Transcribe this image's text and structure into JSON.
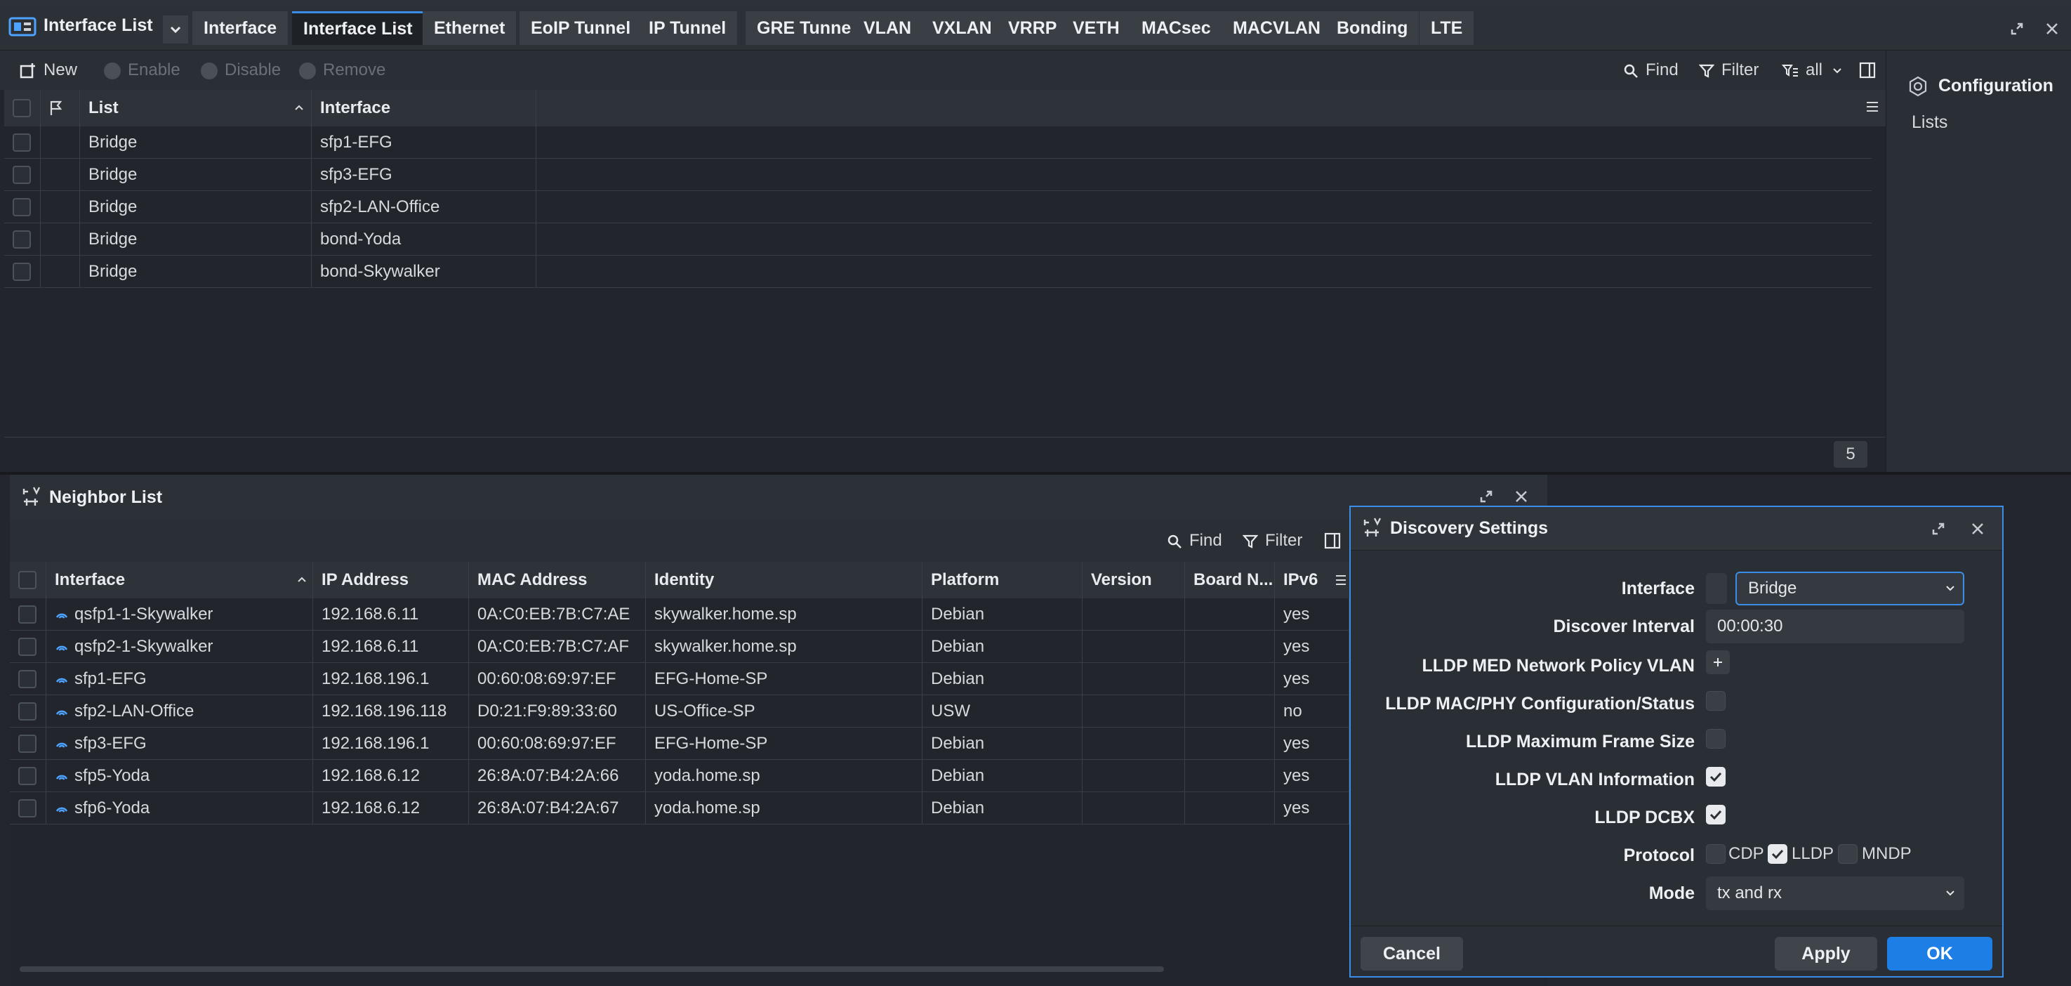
{
  "interface_window": {
    "title": "Interface List",
    "tabs": [
      {
        "label": "Interface",
        "active": false
      },
      {
        "label": "Interface List",
        "active": true
      },
      {
        "label": "Ethernet",
        "active": false
      },
      {
        "label": "EoIP Tunnel",
        "active": false
      },
      {
        "label": "IP Tunnel",
        "active": false
      },
      {
        "label": "GRE Tunnel",
        "active": false
      },
      {
        "label": "VLAN",
        "active": false
      },
      {
        "label": "VXLAN",
        "active": false
      },
      {
        "label": "VRRP",
        "active": false
      },
      {
        "label": "VETH",
        "active": false
      },
      {
        "label": "MACsec",
        "active": false
      },
      {
        "label": "MACVLAN",
        "active": false
      },
      {
        "label": "Bonding",
        "active": false
      },
      {
        "label": "LTE",
        "active": false
      }
    ],
    "toolbar": {
      "new": "New",
      "enable": "Enable",
      "disable": "Disable",
      "remove": "Remove",
      "find": "Find",
      "filter": "Filter",
      "view": "all"
    },
    "table": {
      "columns": [
        "List",
        "Interface"
      ],
      "rows": [
        {
          "list": "Bridge",
          "interface": "sfp1-EFG"
        },
        {
          "list": "Bridge",
          "interface": "sfp3-EFG"
        },
        {
          "list": "Bridge",
          "interface": "sfp2-LAN-Office"
        },
        {
          "list": "Bridge",
          "interface": "bond-Yoda"
        },
        {
          "list": "Bridge",
          "interface": "bond-Skywalker"
        }
      ],
      "count": "5"
    },
    "side_panel": {
      "title": "Configuration",
      "item": "Lists"
    }
  },
  "neighbor_window": {
    "title": "Neighbor List",
    "toolbar": {
      "find": "Find",
      "filter": "Filter"
    },
    "table": {
      "columns": [
        "Interface",
        "IP Address",
        "MAC Address",
        "Identity",
        "Platform",
        "Version",
        "Board N...",
        "IPv6"
      ],
      "rows": [
        {
          "interface": "qsfp1-1-Skywalker",
          "ip": "192.168.6.11",
          "mac": "0A:C0:EB:7B:C7:AE",
          "identity": "skywalker.home.sp",
          "platform": "Debian",
          "version": "",
          "board": "",
          "ipv6": "yes"
        },
        {
          "interface": "qsfp2-1-Skywalker",
          "ip": "192.168.6.11",
          "mac": "0A:C0:EB:7B:C7:AF",
          "identity": "skywalker.home.sp",
          "platform": "Debian",
          "version": "",
          "board": "",
          "ipv6": "yes"
        },
        {
          "interface": "sfp1-EFG",
          "ip": "192.168.196.1",
          "mac": "00:60:08:69:97:EF",
          "identity": "EFG-Home-SP",
          "platform": "Debian",
          "version": "",
          "board": "",
          "ipv6": "yes"
        },
        {
          "interface": "sfp2-LAN-Office",
          "ip": "192.168.196.118",
          "mac": "D0:21:F9:89:33:60",
          "identity": "US-Office-SP",
          "platform": "USW",
          "version": "",
          "board": "",
          "ipv6": "no"
        },
        {
          "interface": "sfp3-EFG",
          "ip": "192.168.196.1",
          "mac": "00:60:08:69:97:EF",
          "identity": "EFG-Home-SP",
          "platform": "Debian",
          "version": "",
          "board": "",
          "ipv6": "yes"
        },
        {
          "interface": "sfp5-Yoda",
          "ip": "192.168.6.12",
          "mac": "26:8A:07:B4:2A:66",
          "identity": "yoda.home.sp",
          "platform": "Debian",
          "version": "",
          "board": "",
          "ipv6": "yes"
        },
        {
          "interface": "sfp6-Yoda",
          "ip": "192.168.6.12",
          "mac": "26:8A:07:B4:2A:67",
          "identity": "yoda.home.sp",
          "platform": "Debian",
          "version": "",
          "board": "",
          "ipv6": "yes"
        }
      ]
    }
  },
  "discovery_dialog": {
    "title": "Discovery Settings",
    "fields": {
      "interface_label": "Interface",
      "interface_value": "Bridge",
      "discover_interval_label": "Discover Interval",
      "discover_interval_value": "00:00:30",
      "lldp_med_label": "LLDP MED Network Policy VLAN",
      "lldp_mac_phy_label": "LLDP MAC/PHY Configuration/Status",
      "lldp_mac_phy_checked": false,
      "lldp_max_frame_label": "LLDP Maximum Frame Size",
      "lldp_max_frame_checked": false,
      "lldp_vlan_label": "LLDP VLAN Information",
      "lldp_vlan_checked": true,
      "lldp_dcbx_label": "LLDP DCBX",
      "lldp_dcbx_checked": true,
      "protocol_label": "Protocol",
      "protocols": [
        {
          "label": "CDP",
          "checked": false
        },
        {
          "label": "LLDP",
          "checked": true
        },
        {
          "label": "MNDP",
          "checked": false
        }
      ],
      "mode_label": "Mode",
      "mode_value": "tx and rx"
    },
    "buttons": {
      "cancel": "Cancel",
      "apply": "Apply",
      "ok": "OK"
    }
  },
  "colors": {
    "accent": "#3b8ee8",
    "background": "#22262c",
    "link_icon": "#4da3ff"
  }
}
